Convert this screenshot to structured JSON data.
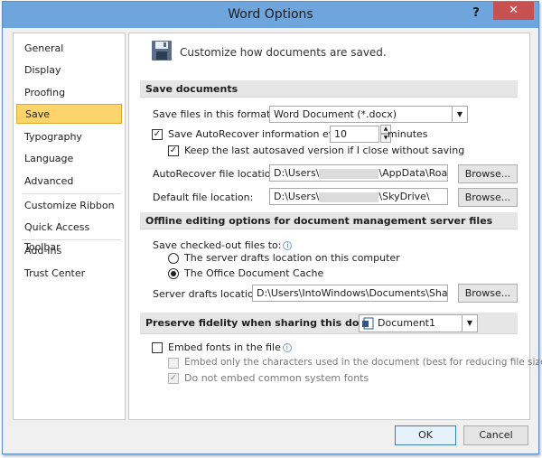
{
  "window": {
    "title": "Word Options",
    "help_label": "?",
    "close_label": "✕"
  },
  "sidebar": {
    "items": [
      {
        "label": "General"
      },
      {
        "label": "Display"
      },
      {
        "label": "Proofing"
      },
      {
        "label": "Save"
      },
      {
        "label": "Typography"
      },
      {
        "label": "Language"
      },
      {
        "label": "Advanced"
      },
      {
        "label": "Customize Ribbon"
      },
      {
        "label": "Quick Access Toolbar"
      },
      {
        "label": "Add-Ins"
      },
      {
        "label": "Trust Center"
      }
    ],
    "selected": "Save"
  },
  "header": {
    "text": "Customize how documents are saved.",
    "icon": "floppy-disk-icon"
  },
  "save_documents": {
    "section_title": "Save documents",
    "format_label": "Save files in this format:",
    "format_value": "Word Document (*.docx)",
    "autorecover_label": "Save AutoRecover information every",
    "autorecover_checked": true,
    "autorecover_minutes": "10",
    "minutes_label": "minutes",
    "keep_last_label": "Keep the last autosaved version if I close without saving",
    "keep_last_checked": true,
    "autorecover_location_label": "AutoRecover file location:",
    "autorecover_location_prefix": "D:\\Users\\",
    "autorecover_location_suffix": "\\AppData\\Roamin",
    "default_location_label": "Default file location:",
    "default_location_prefix": "D:\\Users\\",
    "default_location_suffix": "\\SkyDrive\\",
    "browse_label": "Browse..."
  },
  "offline": {
    "section_title": "Offline editing options for document management server files",
    "checked_out_label": "Save checked-out files to:",
    "radio_server_label": "The server drafts location on this computer",
    "radio_cache_label": "The Office Document Cache",
    "selected": "cache",
    "server_drafts_label": "Server drafts location:",
    "server_drafts_value": "D:\\Users\\IntoWindows\\Documents\\SharePoi",
    "browse_label": "Browse..."
  },
  "fidelity": {
    "section_title": "Preserve fidelity when sharing this document:",
    "document_value": "Document1",
    "embed_fonts_label": "Embed fonts in the file",
    "embed_fonts_checked": false,
    "embed_chars_label": "Embed only the characters used in the document (best for reducing file size)",
    "embed_chars_checked": false,
    "no_common_label": "Do not embed common system fonts",
    "no_common_checked": true
  },
  "footer": {
    "ok_label": "OK",
    "cancel_label": "Cancel"
  },
  "colors": {
    "title_bar": "#6fa5dd",
    "close_button": "#c75050",
    "selected_item": "#fbd46b"
  }
}
